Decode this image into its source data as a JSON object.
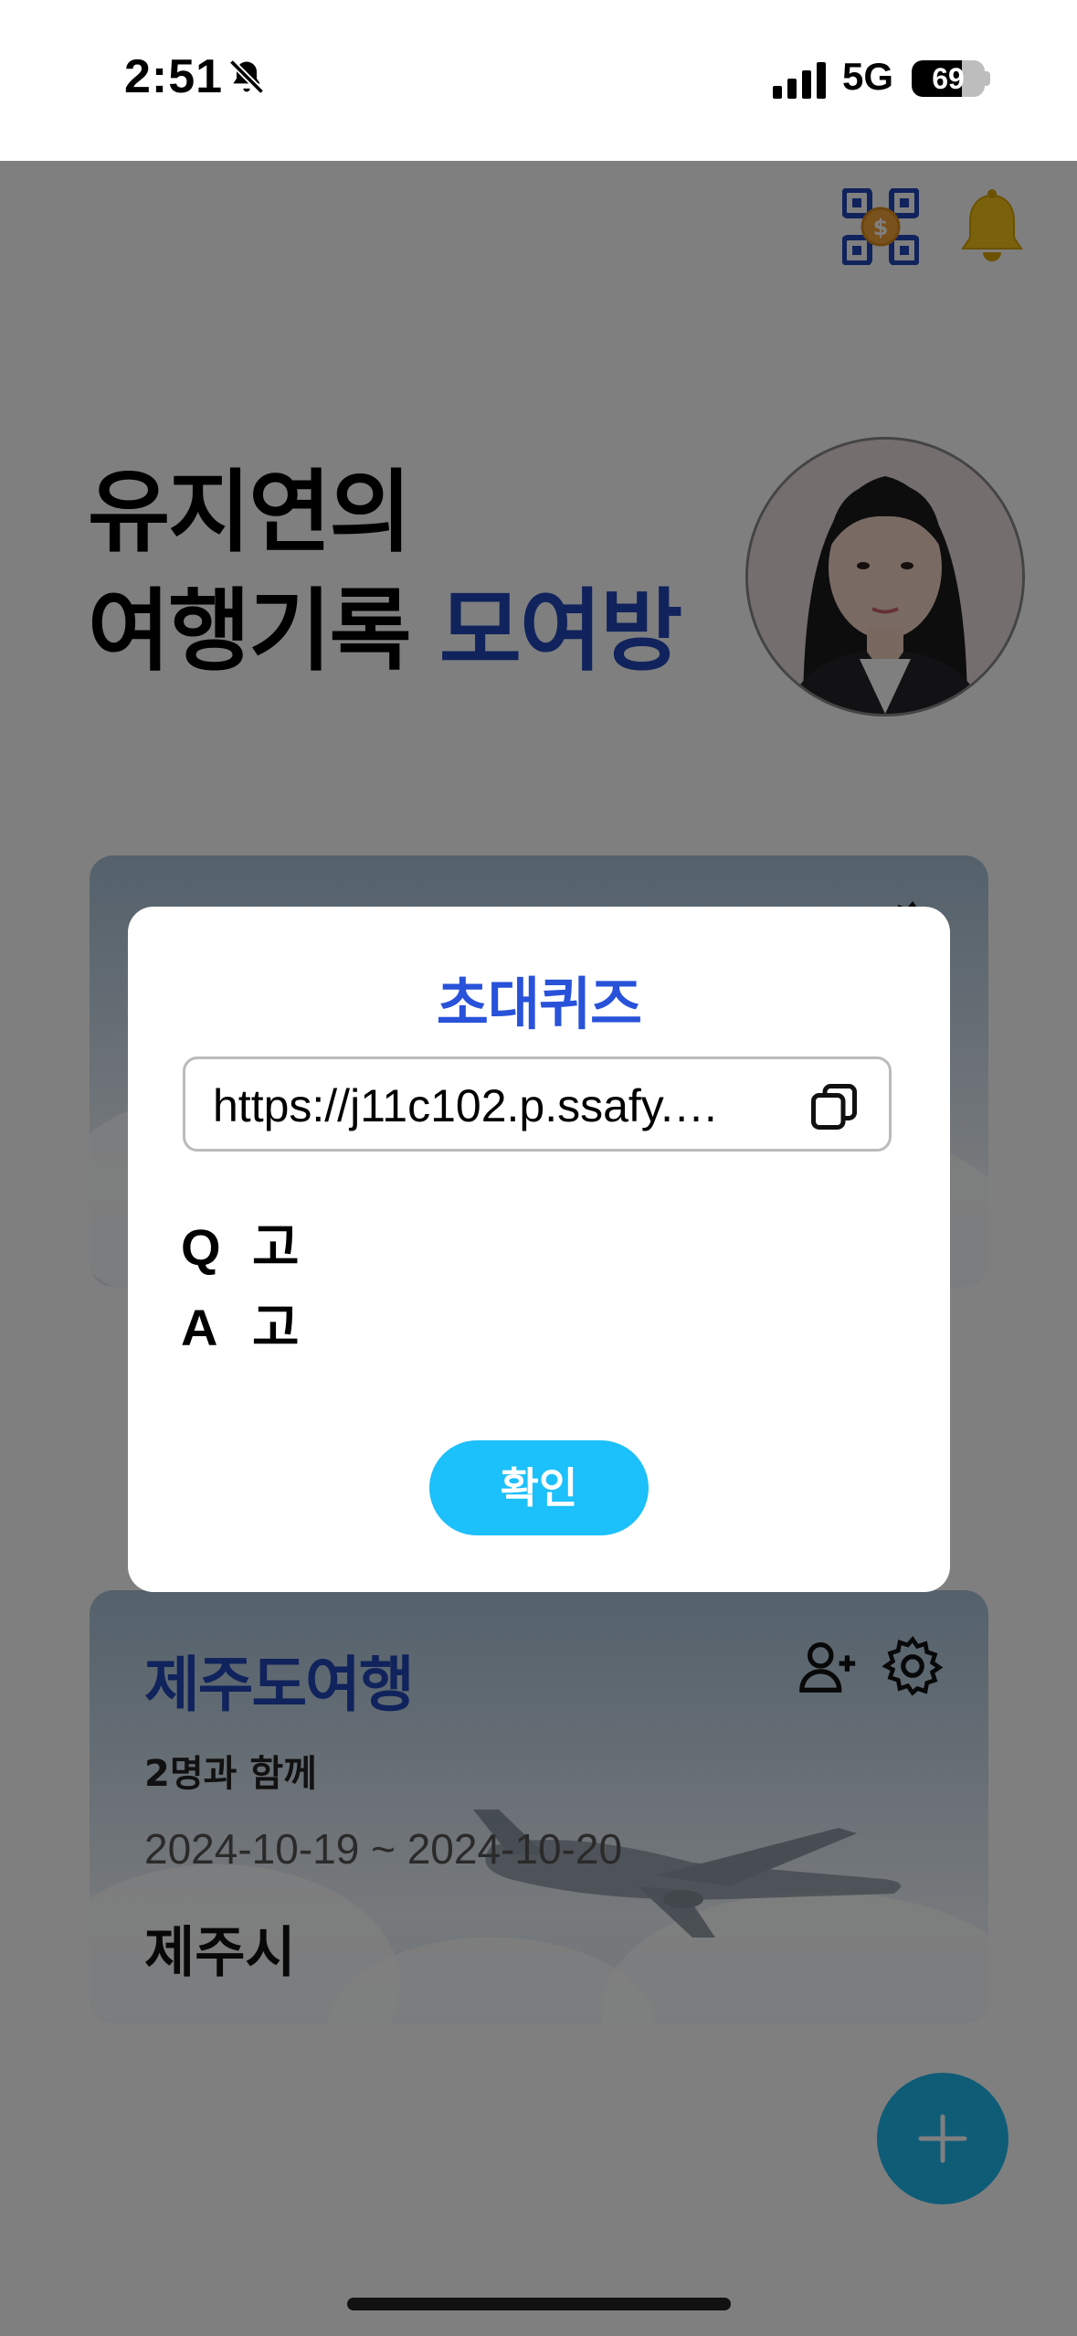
{
  "status_bar": {
    "time": "2:51",
    "network": "5G",
    "battery": "69",
    "battery_level": 0.69
  },
  "header": {
    "qr_icon": "qr-coin-icon",
    "bell_icon": "bell-icon"
  },
  "title": {
    "line1": "유지연의",
    "line2_main": "여행기록",
    "line2_accent": "모여방"
  },
  "trips": [
    {
      "title": "",
      "members": "",
      "dates": "",
      "city": ""
    },
    {
      "title": "제주도여행",
      "members": "2명과 함께",
      "dates": "2024-10-19 ~ 2024-10-20",
      "city": "제주시"
    }
  ],
  "fab": {
    "icon": "plus-icon"
  },
  "modal": {
    "title": "초대퀴즈",
    "link": "https://j11c102.p.ssafy.…",
    "q_label": "Q",
    "q_text": "고",
    "a_label": "A",
    "a_text": "고",
    "confirm_label": "확인"
  },
  "colors": {
    "accent": "#2146b8",
    "modal_title": "#2852d9",
    "button": "#1cc0fb"
  }
}
